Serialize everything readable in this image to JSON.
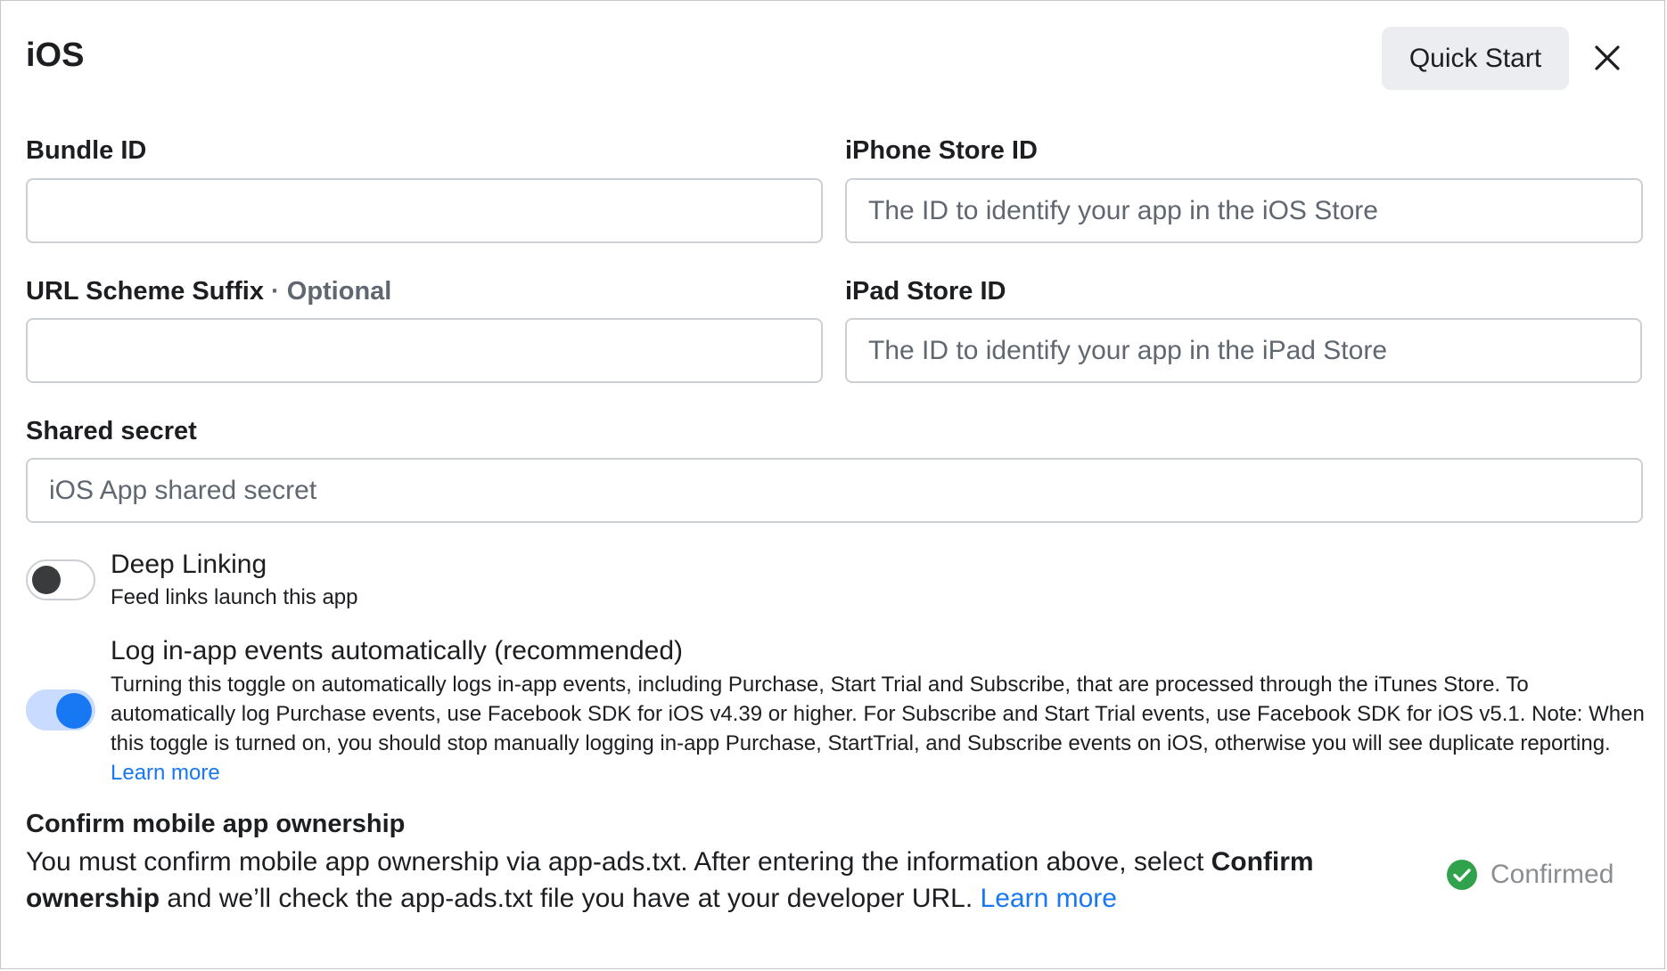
{
  "dialog": {
    "title": "iOS",
    "quick_start_label": "Quick Start",
    "close_label": "Close"
  },
  "fields": {
    "bundle_id": {
      "label": "Bundle ID",
      "value": "",
      "placeholder": ""
    },
    "iphone_store_id": {
      "label": "iPhone Store ID",
      "value": "",
      "placeholder": "The ID to identify your app in the iOS Store"
    },
    "url_scheme_suffix": {
      "label": "URL Scheme Suffix",
      "optional_tag": " · Optional",
      "value": "",
      "placeholder": ""
    },
    "ipad_store_id": {
      "label": "iPad Store ID",
      "value": "",
      "placeholder": "The ID to identify your app in the iPad Store"
    },
    "shared_secret": {
      "label": "Shared secret",
      "value": "",
      "placeholder": "iOS App shared secret"
    }
  },
  "toggles": {
    "deep_linking": {
      "title": "Deep Linking",
      "description": "Feed links launch this app",
      "state": "off"
    },
    "log_events": {
      "title": "Log in-app events automatically (recommended)",
      "description": "Turning this toggle on automatically logs in-app events, including Purchase, Start Trial and Subscribe, that are processed through the iTunes Store. To automatically log Purchase events, use Facebook SDK for iOS v4.39 or higher. For Subscribe and Start Trial events, use Facebook SDK for iOS v5.1. Note: When this toggle is turned on, you should stop manually logging in-app Purchase, StartTrial, and Subscribe events on iOS, otherwise you will see duplicate reporting.",
      "learn_more": "Learn more",
      "state": "on"
    }
  },
  "ownership": {
    "heading": "Confirm mobile app ownership",
    "text_before": "You must confirm mobile app ownership via app-ads.txt. After entering the information above, select ",
    "bold_text": "Confirm ownership",
    "text_after": " and we’ll check the app-ads.txt file you have at your developer URL. ",
    "learn_more": "Learn more",
    "status_label": "Confirmed",
    "status_icon": "check-circle-icon"
  },
  "colors": {
    "accent": "#1877f2",
    "success": "#31a24c",
    "muted_text": "#606770"
  }
}
